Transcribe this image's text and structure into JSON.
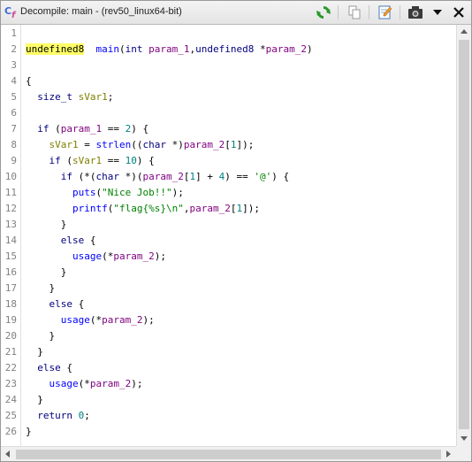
{
  "window": {
    "title": "Decompile: main -  (rev50_linux64-bit)"
  },
  "toolbar": {
    "icons": [
      "refresh-icon",
      "copy-icon",
      "edit-icon",
      "snapshot-icon",
      "menu-dropdown-icon",
      "close-icon"
    ]
  },
  "code": {
    "line_numbers": [
      "1",
      "2",
      "3",
      "4",
      "5",
      "6",
      "7",
      "8",
      "9",
      "10",
      "11",
      "12",
      "13",
      "14",
      "15",
      "16",
      "17",
      "18",
      "19",
      "20",
      "21",
      "22",
      "23",
      "24",
      "25",
      "26"
    ],
    "lines": [
      {
        "segs": []
      },
      {
        "segs": [
          [
            "hl",
            "undefined8"
          ],
          [
            "",
            "  "
          ],
          [
            "fn",
            "main"
          ],
          [
            "",
            "("
          ],
          [
            "ty",
            "int"
          ],
          [
            "",
            " "
          ],
          [
            "pa",
            "param_1"
          ],
          [
            "",
            ","
          ],
          [
            "ty",
            "undefined8"
          ],
          [
            "",
            " *"
          ],
          [
            "pa",
            "param_2"
          ],
          [
            "",
            ")"
          ]
        ]
      },
      {
        "segs": []
      },
      {
        "segs": [
          [
            "",
            "{"
          ]
        ]
      },
      {
        "segs": [
          [
            "",
            "  "
          ],
          [
            "ty",
            "size_t"
          ],
          [
            "",
            " "
          ],
          [
            "lv",
            "sVar1"
          ],
          [
            "",
            ";"
          ]
        ]
      },
      {
        "segs": []
      },
      {
        "segs": [
          [
            "",
            "  "
          ],
          [
            "kw",
            "if"
          ],
          [
            "",
            " ("
          ],
          [
            "pa",
            "param_1"
          ],
          [
            "",
            " == "
          ],
          [
            "num",
            "2"
          ],
          [
            "",
            ") {"
          ]
        ]
      },
      {
        "segs": [
          [
            "",
            "    "
          ],
          [
            "lv",
            "sVar1"
          ],
          [
            "",
            " = "
          ],
          [
            "fn",
            "strlen"
          ],
          [
            "",
            "(("
          ],
          [
            "ty",
            "char"
          ],
          [
            "",
            " *)"
          ],
          [
            "pa",
            "param_2"
          ],
          [
            "",
            "["
          ],
          [
            "num",
            "1"
          ],
          [
            "",
            "]);"
          ]
        ]
      },
      {
        "segs": [
          [
            "",
            "    "
          ],
          [
            "kw",
            "if"
          ],
          [
            "",
            " ("
          ],
          [
            "lv",
            "sVar1"
          ],
          [
            "",
            " == "
          ],
          [
            "num",
            "10"
          ],
          [
            "",
            ") {"
          ]
        ]
      },
      {
        "segs": [
          [
            "",
            "      "
          ],
          [
            "kw",
            "if"
          ],
          [
            "",
            " (*("
          ],
          [
            "ty",
            "char"
          ],
          [
            "",
            " *)("
          ],
          [
            "pa",
            "param_2"
          ],
          [
            "",
            "["
          ],
          [
            "num",
            "1"
          ],
          [
            "",
            "] + "
          ],
          [
            "num",
            "4"
          ],
          [
            "",
            ") == "
          ],
          [
            "str",
            "'@'"
          ],
          [
            "",
            ") {"
          ]
        ]
      },
      {
        "segs": [
          [
            "",
            "        "
          ],
          [
            "fn",
            "puts"
          ],
          [
            "",
            "("
          ],
          [
            "str",
            "\"Nice Job!!\""
          ],
          [
            "",
            ");"
          ]
        ]
      },
      {
        "segs": [
          [
            "",
            "        "
          ],
          [
            "fn",
            "printf"
          ],
          [
            "",
            "("
          ],
          [
            "str",
            "\"flag{%s}\\n\""
          ],
          [
            "",
            ","
          ],
          [
            "pa",
            "param_2"
          ],
          [
            "",
            "["
          ],
          [
            "num",
            "1"
          ],
          [
            "",
            "]);"
          ]
        ]
      },
      {
        "segs": [
          [
            "",
            "      }"
          ]
        ]
      },
      {
        "segs": [
          [
            "",
            "      "
          ],
          [
            "kw",
            "else"
          ],
          [
            "",
            " {"
          ]
        ]
      },
      {
        "segs": [
          [
            "",
            "        "
          ],
          [
            "fn",
            "usage"
          ],
          [
            "",
            "(*"
          ],
          [
            "pa",
            "param_2"
          ],
          [
            "",
            ");"
          ]
        ]
      },
      {
        "segs": [
          [
            "",
            "      }"
          ]
        ]
      },
      {
        "segs": [
          [
            "",
            "    }"
          ]
        ]
      },
      {
        "segs": [
          [
            "",
            "    "
          ],
          [
            "kw",
            "else"
          ],
          [
            "",
            " {"
          ]
        ]
      },
      {
        "segs": [
          [
            "",
            "      "
          ],
          [
            "fn",
            "usage"
          ],
          [
            "",
            "(*"
          ],
          [
            "pa",
            "param_2"
          ],
          [
            "",
            ");"
          ]
        ]
      },
      {
        "segs": [
          [
            "",
            "    }"
          ]
        ]
      },
      {
        "segs": [
          [
            "",
            "  }"
          ]
        ]
      },
      {
        "segs": [
          [
            "",
            "  "
          ],
          [
            "kw",
            "else"
          ],
          [
            "",
            " {"
          ]
        ]
      },
      {
        "segs": [
          [
            "",
            "    "
          ],
          [
            "fn",
            "usage"
          ],
          [
            "",
            "(*"
          ],
          [
            "pa",
            "param_2"
          ],
          [
            "",
            ");"
          ]
        ]
      },
      {
        "segs": [
          [
            "",
            "  }"
          ]
        ]
      },
      {
        "segs": [
          [
            "",
            "  "
          ],
          [
            "kw",
            "return"
          ],
          [
            "",
            " "
          ],
          [
            "num",
            "0"
          ],
          [
            "",
            ";"
          ]
        ]
      },
      {
        "segs": [
          [
            "",
            "}"
          ]
        ]
      }
    ]
  },
  "colors": {
    "keyword": "#00007f",
    "function": "#0000ff",
    "parameter": "#7f007f",
    "local_var": "#7f7f00",
    "number": "#008080",
    "string": "#008000",
    "highlight": "#ffff66"
  }
}
